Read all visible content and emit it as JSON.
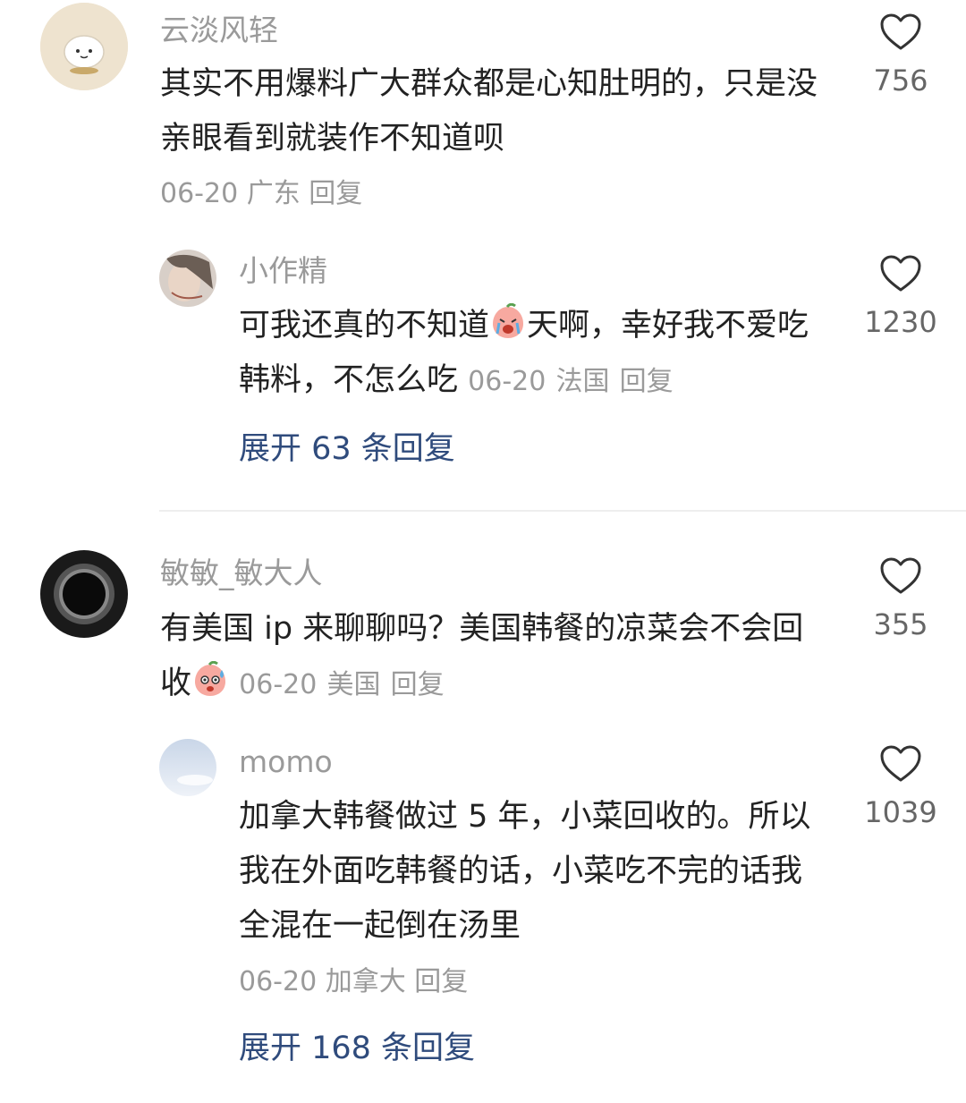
{
  "comments": [
    {
      "username": "云淡风轻",
      "text": "其实不用爆料广大群众都是心知肚明的，只是没亲眼看到就装作不知道呗",
      "date": "06-20",
      "location": "广东",
      "reply_label": "回复",
      "likes": "756",
      "replies": [
        {
          "username": "小作精",
          "text_before_emoji": "可我还真的不知道",
          "emoji": "crying-peach-emoji",
          "text_after_emoji": "天啊，幸好我不爱吃韩料，不怎么吃",
          "date": "06-20",
          "location": "法国",
          "reply_label": "回复",
          "likes": "1230"
        }
      ],
      "expand_label": "展开 63 条回复"
    },
    {
      "username": "敏敏_敏大人",
      "text_before_emoji": "有美国 ip 来聊聊吗？美国韩餐的凉菜会不会回收",
      "emoji": "sweating-peach-emoji",
      "date": "06-20",
      "location": "美国",
      "reply_label": "回复",
      "likes": "355",
      "replies": [
        {
          "username": "momo",
          "text": "加拿大韩餐做过 5 年，小菜回收的。所以我在外面吃韩餐的话，小菜吃不完的话我全混在一起倒在汤里",
          "date": "06-20",
          "location": "加拿大",
          "reply_label": "回复",
          "likes": "1039"
        }
      ],
      "expand_label": "展开 168 条回复"
    }
  ],
  "colors": {
    "link": "#2f4b7c",
    "meta": "#9a9a9a",
    "text": "#222222"
  }
}
